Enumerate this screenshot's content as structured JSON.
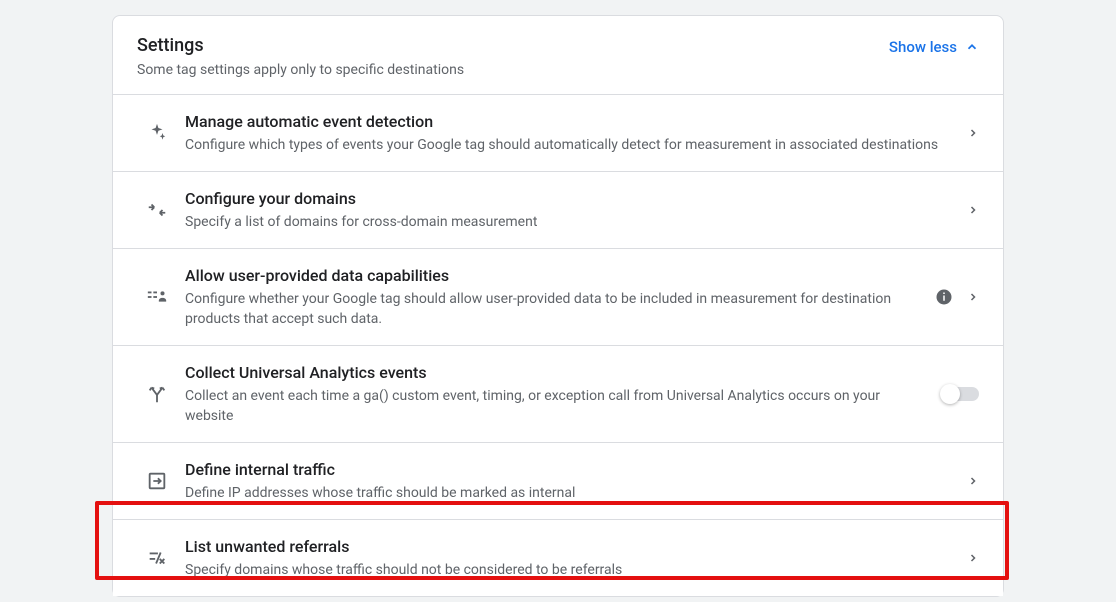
{
  "header": {
    "title": "Settings",
    "subtitle": "Some tag settings apply only to specific destinations",
    "toggle_label": "Show less"
  },
  "rows": [
    {
      "id": "auto-event",
      "title": "Manage automatic event detection",
      "desc": "Configure which types of events your Google tag should automatically detect for measurement in associated destinations"
    },
    {
      "id": "domains",
      "title": "Configure your domains",
      "desc": "Specify a list of domains for cross-domain measurement"
    },
    {
      "id": "user-data",
      "title": "Allow user-provided data capabilities",
      "desc": "Configure whether your Google tag should allow user-provided data to be included in measurement for destination products that accept such data."
    },
    {
      "id": "ua-events",
      "title": "Collect Universal Analytics events",
      "desc": "Collect an event each time a ga() custom event, timing, or exception call from Universal Analytics occurs on your website"
    },
    {
      "id": "internal-traffic",
      "title": "Define internal traffic",
      "desc": "Define IP addresses whose traffic should be marked as internal"
    },
    {
      "id": "unwanted-referrals",
      "title": "List unwanted referrals",
      "desc": "Specify domains whose traffic should not be considered to be referrals"
    }
  ]
}
